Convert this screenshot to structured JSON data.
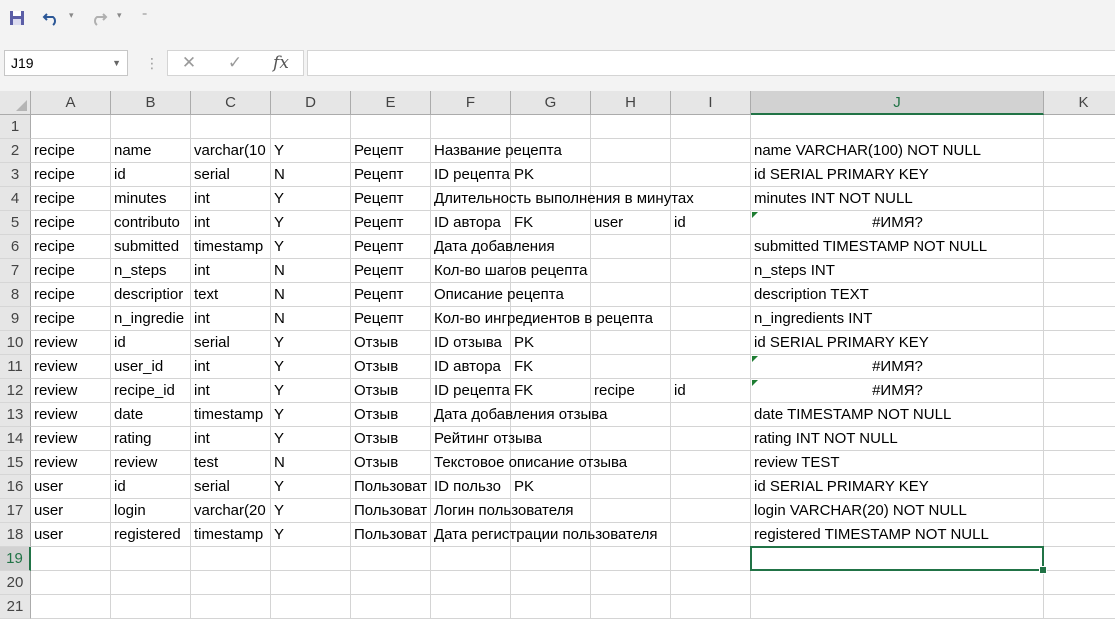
{
  "toolbar": {
    "save_icon": "save-icon",
    "undo_icon": "undo-icon",
    "redo_icon": "redo-icon",
    "customize_icon": "customize-qat-icon"
  },
  "formula_bar": {
    "name_box": "J19",
    "cancel_glyph": "✕",
    "enter_glyph": "✓",
    "fx_glyph": "fx",
    "formula": ""
  },
  "columns": [
    "A",
    "B",
    "C",
    "D",
    "E",
    "F",
    "G",
    "H",
    "I",
    "J",
    "K"
  ],
  "selected_cell": "J19",
  "rows": [
    {
      "n": "1",
      "cells": []
    },
    {
      "n": "2",
      "cells": [
        {
          "c": "A",
          "v": "recipe"
        },
        {
          "c": "B",
          "v": "name"
        },
        {
          "c": "C",
          "v": "varchar(10"
        },
        {
          "c": "D",
          "v": "Y"
        },
        {
          "c": "E",
          "v": "Рецепт"
        },
        {
          "c": "F",
          "v": "Название рецепта"
        },
        {
          "c": "J",
          "v": "name VARCHAR(100)  NOT NULL"
        }
      ]
    },
    {
      "n": "3",
      "cells": [
        {
          "c": "A",
          "v": "recipe"
        },
        {
          "c": "B",
          "v": "id"
        },
        {
          "c": "C",
          "v": "serial"
        },
        {
          "c": "D",
          "v": "N"
        },
        {
          "c": "E",
          "v": "Рецепт"
        },
        {
          "c": "F",
          "v": "ID рецепта"
        },
        {
          "c": "G",
          "v": "PK"
        },
        {
          "c": "J",
          "v": "id SERIAL PRIMARY  KEY"
        }
      ]
    },
    {
      "n": "4",
      "cells": [
        {
          "c": "A",
          "v": "recipe"
        },
        {
          "c": "B",
          "v": "minutes"
        },
        {
          "c": "C",
          "v": "int"
        },
        {
          "c": "D",
          "v": "Y"
        },
        {
          "c": "E",
          "v": "Рецепт"
        },
        {
          "c": "F",
          "v": "Длительность выполнения в минутах"
        },
        {
          "c": "J",
          "v": "minutes INT  NOT NULL"
        }
      ]
    },
    {
      "n": "5",
      "cells": [
        {
          "c": "A",
          "v": "recipe"
        },
        {
          "c": "B",
          "v": "contributo"
        },
        {
          "c": "C",
          "v": "int"
        },
        {
          "c": "D",
          "v": "Y"
        },
        {
          "c": "E",
          "v": "Рецепт"
        },
        {
          "c": "F",
          "v": "ID автора"
        },
        {
          "c": "G",
          "v": "FK"
        },
        {
          "c": "H",
          "v": "user"
        },
        {
          "c": "I",
          "v": "id"
        },
        {
          "c": "J",
          "v": "#ИМЯ?",
          "err": true
        }
      ]
    },
    {
      "n": "6",
      "cells": [
        {
          "c": "A",
          "v": "recipe"
        },
        {
          "c": "B",
          "v": "submitted"
        },
        {
          "c": "C",
          "v": "timestamp"
        },
        {
          "c": "D",
          "v": "Y"
        },
        {
          "c": "E",
          "v": "Рецепт"
        },
        {
          "c": "F",
          "v": "Дата добавления"
        },
        {
          "c": "J",
          "v": "submitted TIMESTAMP  NOT NULL"
        }
      ]
    },
    {
      "n": "7",
      "cells": [
        {
          "c": "A",
          "v": "recipe"
        },
        {
          "c": "B",
          "v": "n_steps"
        },
        {
          "c": "C",
          "v": "int"
        },
        {
          "c": "D",
          "v": "N"
        },
        {
          "c": "E",
          "v": "Рецепт"
        },
        {
          "c": "F",
          "v": "Кол-во шагов рецепта"
        },
        {
          "c": "J",
          "v": "n_steps INT"
        }
      ]
    },
    {
      "n": "8",
      "cells": [
        {
          "c": "A",
          "v": "recipe"
        },
        {
          "c": "B",
          "v": "descriptior"
        },
        {
          "c": "C",
          "v": "text"
        },
        {
          "c": "D",
          "v": "N"
        },
        {
          "c": "E",
          "v": "Рецепт"
        },
        {
          "c": "F",
          "v": "Описание рецепта"
        },
        {
          "c": "J",
          "v": "description TEXT"
        }
      ]
    },
    {
      "n": "9",
      "cells": [
        {
          "c": "A",
          "v": "recipe"
        },
        {
          "c": "B",
          "v": "n_ingredie"
        },
        {
          "c": "C",
          "v": "int"
        },
        {
          "c": "D",
          "v": "N"
        },
        {
          "c": "E",
          "v": "Рецепт"
        },
        {
          "c": "F",
          "v": "Кол-во ингредиентов в рецепта"
        },
        {
          "c": "J",
          "v": "n_ingredients INT"
        }
      ]
    },
    {
      "n": "10",
      "cells": [
        {
          "c": "A",
          "v": "review"
        },
        {
          "c": "B",
          "v": "id"
        },
        {
          "c": "C",
          "v": "serial"
        },
        {
          "c": "D",
          "v": "Y"
        },
        {
          "c": "E",
          "v": "Отзыв"
        },
        {
          "c": "F",
          "v": "ID отзыва"
        },
        {
          "c": "G",
          "v": "PK"
        },
        {
          "c": "J",
          "v": "id SERIAL PRIMARY  KEY"
        }
      ]
    },
    {
      "n": "11",
      "cells": [
        {
          "c": "A",
          "v": "review"
        },
        {
          "c": "B",
          "v": "user_id"
        },
        {
          "c": "C",
          "v": "int"
        },
        {
          "c": "D",
          "v": "Y"
        },
        {
          "c": "E",
          "v": "Отзыв"
        },
        {
          "c": "F",
          "v": "ID автора"
        },
        {
          "c": "G",
          "v": "FK"
        },
        {
          "c": "J",
          "v": "#ИМЯ?",
          "err": true
        }
      ]
    },
    {
      "n": "12",
      "cells": [
        {
          "c": "A",
          "v": "review"
        },
        {
          "c": "B",
          "v": "recipe_id"
        },
        {
          "c": "C",
          "v": "int"
        },
        {
          "c": "D",
          "v": "Y"
        },
        {
          "c": "E",
          "v": "Отзыв"
        },
        {
          "c": "F",
          "v": "ID рецепта"
        },
        {
          "c": "G",
          "v": "FK"
        },
        {
          "c": "H",
          "v": "recipe"
        },
        {
          "c": "I",
          "v": "id"
        },
        {
          "c": "J",
          "v": "#ИМЯ?",
          "err": true
        }
      ]
    },
    {
      "n": "13",
      "cells": [
        {
          "c": "A",
          "v": "review"
        },
        {
          "c": "B",
          "v": "date"
        },
        {
          "c": "C",
          "v": "timestamp"
        },
        {
          "c": "D",
          "v": "Y"
        },
        {
          "c": "E",
          "v": "Отзыв"
        },
        {
          "c": "F",
          "v": "Дата добавления отзыва"
        },
        {
          "c": "J",
          "v": "date TIMESTAMP  NOT NULL"
        }
      ]
    },
    {
      "n": "14",
      "cells": [
        {
          "c": "A",
          "v": "review"
        },
        {
          "c": "B",
          "v": "rating"
        },
        {
          "c": "C",
          "v": "int"
        },
        {
          "c": "D",
          "v": "Y"
        },
        {
          "c": "E",
          "v": "Отзыв"
        },
        {
          "c": "F",
          "v": "Рейтинг отзыва"
        },
        {
          "c": "J",
          "v": "rating INT  NOT NULL"
        }
      ]
    },
    {
      "n": "15",
      "cells": [
        {
          "c": "A",
          "v": "review"
        },
        {
          "c": "B",
          "v": "review"
        },
        {
          "c": "C",
          "v": "test"
        },
        {
          "c": "D",
          "v": "N"
        },
        {
          "c": "E",
          "v": "Отзыв"
        },
        {
          "c": "F",
          "v": "Текстовое описание отзыва"
        },
        {
          "c": "J",
          "v": "review TEST"
        }
      ]
    },
    {
      "n": "16",
      "cells": [
        {
          "c": "A",
          "v": "user"
        },
        {
          "c": "B",
          "v": "id"
        },
        {
          "c": "C",
          "v": "serial"
        },
        {
          "c": "D",
          "v": "Y"
        },
        {
          "c": "E",
          "v": "Пользоват"
        },
        {
          "c": "F",
          "v": "ID пользо"
        },
        {
          "c": "G",
          "v": "PK"
        },
        {
          "c": "J",
          "v": "id SERIAL PRIMARY  KEY"
        }
      ]
    },
    {
      "n": "17",
      "cells": [
        {
          "c": "A",
          "v": "user"
        },
        {
          "c": "B",
          "v": "login"
        },
        {
          "c": "C",
          "v": "varchar(20"
        },
        {
          "c": "D",
          "v": "Y"
        },
        {
          "c": "E",
          "v": "Пользоват"
        },
        {
          "c": "F",
          "v": "Логин пользователя"
        },
        {
          "c": "J",
          "v": "login VARCHAR(20)  NOT NULL"
        }
      ]
    },
    {
      "n": "18",
      "cells": [
        {
          "c": "A",
          "v": "user"
        },
        {
          "c": "B",
          "v": "registered"
        },
        {
          "c": "C",
          "v": "timestamp"
        },
        {
          "c": "D",
          "v": "Y"
        },
        {
          "c": "E",
          "v": "Пользоват"
        },
        {
          "c": "F",
          "v": "Дата регистрации пользователя"
        },
        {
          "c": "J",
          "v": "registered TIMESTAMP  NOT NULL"
        }
      ]
    },
    {
      "n": "19",
      "cells": []
    },
    {
      "n": "20",
      "cells": []
    },
    {
      "n": "21",
      "cells": []
    }
  ]
}
